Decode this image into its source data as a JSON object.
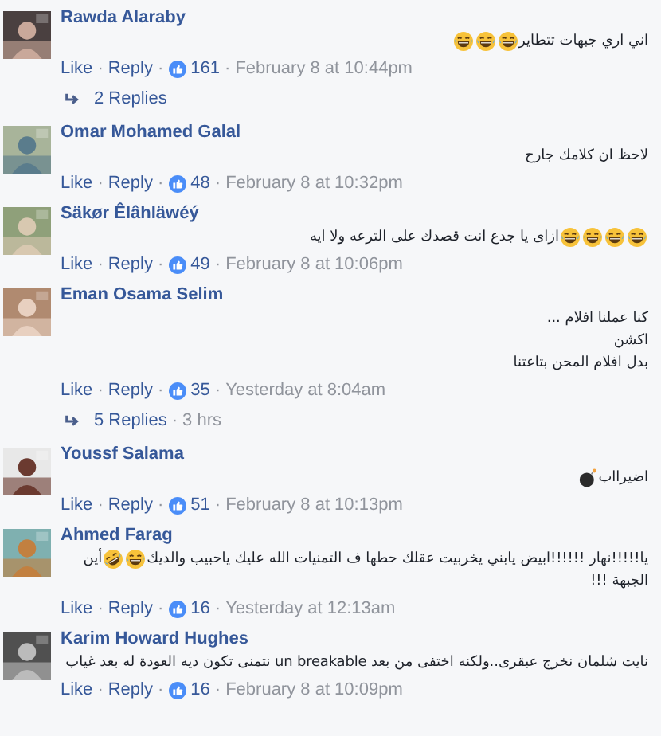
{
  "comments": [
    {
      "name": "Rawda Alaraby",
      "message": [
        {
          "kind": "text",
          "text": "اني اري جبهات تتطاير"
        },
        {
          "kind": "laugh"
        },
        {
          "kind": "laugh"
        },
        {
          "kind": "laugh"
        }
      ],
      "meta": [
        {
          "kind": "link",
          "text": "Like"
        },
        {
          "kind": "sep",
          "text": "·"
        },
        {
          "kind": "link",
          "text": "Reply"
        },
        {
          "kind": "sep",
          "text": "·"
        },
        {
          "kind": "likes",
          "text": "161"
        },
        {
          "kind": "sep",
          "text": "·"
        },
        {
          "kind": "time",
          "text": "February 8 at 10:44pm"
        }
      ],
      "replies": [
        {
          "kind": "link",
          "text": "2 Replies"
        }
      ]
    },
    {
      "name": "Omar Mohamed Galal",
      "message": [
        {
          "kind": "text",
          "text": "لاحظ ان كلامك جارح"
        }
      ],
      "meta": [
        {
          "kind": "link",
          "text": "Like"
        },
        {
          "kind": "sep",
          "text": "·"
        },
        {
          "kind": "link",
          "text": "Reply"
        },
        {
          "kind": "sep",
          "text": "·"
        },
        {
          "kind": "likes",
          "text": "48"
        },
        {
          "kind": "sep",
          "text": "·"
        },
        {
          "kind": "time",
          "text": "February 8 at 10:32pm"
        }
      ]
    },
    {
      "name": "Säkør Êlâhläwéý",
      "message": [
        {
          "kind": "laugh"
        },
        {
          "kind": "laugh"
        },
        {
          "kind": "laugh"
        },
        {
          "kind": "laugh"
        },
        {
          "kind": "text",
          "text": "ازاى يا جدع انت قصدك على الترعه ولا ايه"
        }
      ],
      "meta": [
        {
          "kind": "link",
          "text": "Like"
        },
        {
          "kind": "sep",
          "text": "·"
        },
        {
          "kind": "link",
          "text": "Reply"
        },
        {
          "kind": "sep",
          "text": "·"
        },
        {
          "kind": "likes",
          "text": "49"
        },
        {
          "kind": "sep",
          "text": "·"
        },
        {
          "kind": "time",
          "text": "February 8 at 10:06pm"
        }
      ]
    },
    {
      "name": "Eman Osama Selim",
      "message": [
        {
          "kind": "text",
          "text": "كنا عملنا افلام ..."
        },
        {
          "kind": "break"
        },
        {
          "kind": "text",
          "text": "اكشن"
        },
        {
          "kind": "break"
        },
        {
          "kind": "text",
          "text": "بدل افلام المحن بتاعتنا"
        }
      ],
      "meta": [
        {
          "kind": "link",
          "text": "Like"
        },
        {
          "kind": "sep",
          "text": "·"
        },
        {
          "kind": "link",
          "text": "Reply"
        },
        {
          "kind": "sep",
          "text": "·"
        },
        {
          "kind": "likes",
          "text": "35"
        },
        {
          "kind": "sep",
          "text": "·"
        },
        {
          "kind": "time",
          "text": "Yesterday at 8:04am"
        }
      ],
      "replies": [
        {
          "kind": "link",
          "text": "5 Replies"
        },
        {
          "kind": "sep",
          "text": "·"
        },
        {
          "kind": "time",
          "text": "3 hrs"
        }
      ]
    },
    {
      "name": "Youssf Salama",
      "message": [
        {
          "kind": "text",
          "text": "اضيرااب"
        },
        {
          "kind": "bomb"
        }
      ],
      "meta": [
        {
          "kind": "link",
          "text": "Like"
        },
        {
          "kind": "sep",
          "text": "·"
        },
        {
          "kind": "link",
          "text": "Reply"
        },
        {
          "kind": "sep",
          "text": "·"
        },
        {
          "kind": "likes",
          "text": "51"
        },
        {
          "kind": "sep",
          "text": "·"
        },
        {
          "kind": "time",
          "text": "February 8 at 10:13pm"
        }
      ]
    },
    {
      "name": "Ahmed Farag",
      "message": [
        {
          "kind": "text",
          "text": "يا!!!!!نهار !!!!!!ابيض يابني يخربيت عقلك حطها ف التمنيات الله عليك ياحبيب والديك"
        },
        {
          "kind": "laugh"
        },
        {
          "kind": "rofl"
        },
        {
          "kind": "text",
          "text": "أين"
        },
        {
          "kind": "break"
        },
        {
          "kind": "text",
          "text": "الجبهة !!!"
        }
      ],
      "meta": [
        {
          "kind": "link",
          "text": "Like"
        },
        {
          "kind": "sep",
          "text": "·"
        },
        {
          "kind": "link",
          "text": "Reply"
        },
        {
          "kind": "sep",
          "text": "·"
        },
        {
          "kind": "likes",
          "text": "16"
        },
        {
          "kind": "sep",
          "text": "·"
        },
        {
          "kind": "time",
          "text": "Yesterday at 12:13am"
        }
      ]
    },
    {
      "name": "Karim Howard Hughes",
      "message": [
        {
          "kind": "text",
          "text": "نايت شلمان نخرج عبقرى..ولكنه اختفى من بعد un breakable نتمنى تكون ديه العودة له بعد غياب"
        }
      ],
      "meta": [
        {
          "kind": "link",
          "text": "Like"
        },
        {
          "kind": "sep",
          "text": "·"
        },
        {
          "kind": "link",
          "text": "Reply"
        },
        {
          "kind": "sep",
          "text": "·"
        },
        {
          "kind": "likes",
          "text": "16"
        },
        {
          "kind": "sep",
          "text": "·"
        },
        {
          "kind": "time",
          "text": "February 8 at 10:09pm"
        }
      ]
    }
  ]
}
